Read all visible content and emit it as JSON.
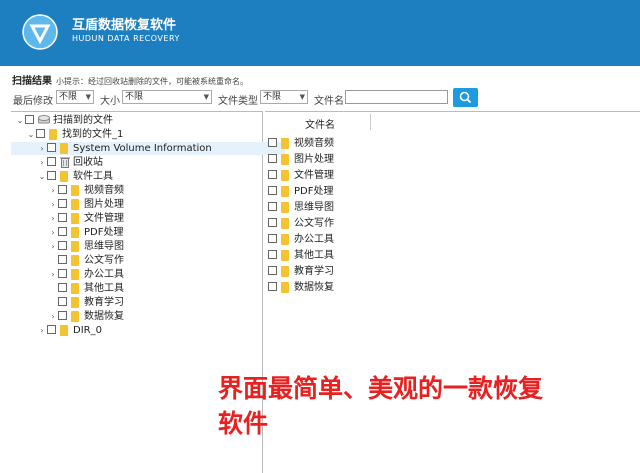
{
  "header": {
    "title": "互盾数据恢复软件",
    "subtitle": "HUDUN DATA RECOVERY",
    "brand_color": "#1e7fc0"
  },
  "scan": {
    "title": "扫描结果",
    "hint": "小提示：经过回收站删除的文件，可能被系统重命名。"
  },
  "filters": {
    "modified_label": "最后修改",
    "modified_value": "不限",
    "size_label": "大小",
    "size_value": "不限",
    "filetype_label": "文件类型",
    "filetype_value": "不限",
    "filename_label": "文件名",
    "filename_value": "",
    "search_icon": "search-icon"
  },
  "tree": [
    {
      "label": "扫描到的文件",
      "expander": "v",
      "icon": "drive-icon"
    },
    {
      "label": "找到的文件_1",
      "expander": "v",
      "icon": "folder-icon"
    },
    {
      "label": "System Volume Information",
      "expander": ">",
      "icon": "folder-icon",
      "selected": true
    },
    {
      "label": "回收站",
      "expander": ">",
      "icon": "recycle-bin-icon"
    },
    {
      "label": "软件工具",
      "expander": "v",
      "icon": "folder-icon"
    },
    {
      "label": "视频音频",
      "expander": ">",
      "icon": "folder-icon"
    },
    {
      "label": "图片处理",
      "expander": ">",
      "icon": "folder-icon"
    },
    {
      "label": "文件管理",
      "expander": ">",
      "icon": "folder-icon"
    },
    {
      "label": "PDF处理",
      "expander": ">",
      "icon": "folder-icon"
    },
    {
      "label": "思维导图",
      "expander": ">",
      "icon": "folder-icon"
    },
    {
      "label": "公文写作",
      "expander": "",
      "icon": "folder-icon"
    },
    {
      "label": "办公工具",
      "expander": ">",
      "icon": "folder-icon"
    },
    {
      "label": "其他工具",
      "expander": "",
      "icon": "folder-icon"
    },
    {
      "label": "教育学习",
      "expander": "",
      "icon": "folder-icon"
    },
    {
      "label": "数据恢复",
      "expander": ">",
      "icon": "folder-icon"
    },
    {
      "label": "DIR_0",
      "expander": ">",
      "icon": "folder-icon"
    }
  ],
  "file_list": {
    "column_name": "文件名",
    "rows": [
      "视频音频",
      "图片处理",
      "文件管理",
      "PDF处理",
      "思维导图",
      "公文写作",
      "办公工具",
      "其他工具",
      "教育学习",
      "数据恢复"
    ]
  },
  "overlay": {
    "line1": "界面最简单、美观的一款恢复",
    "line2": "软件",
    "color": "#e82020"
  }
}
